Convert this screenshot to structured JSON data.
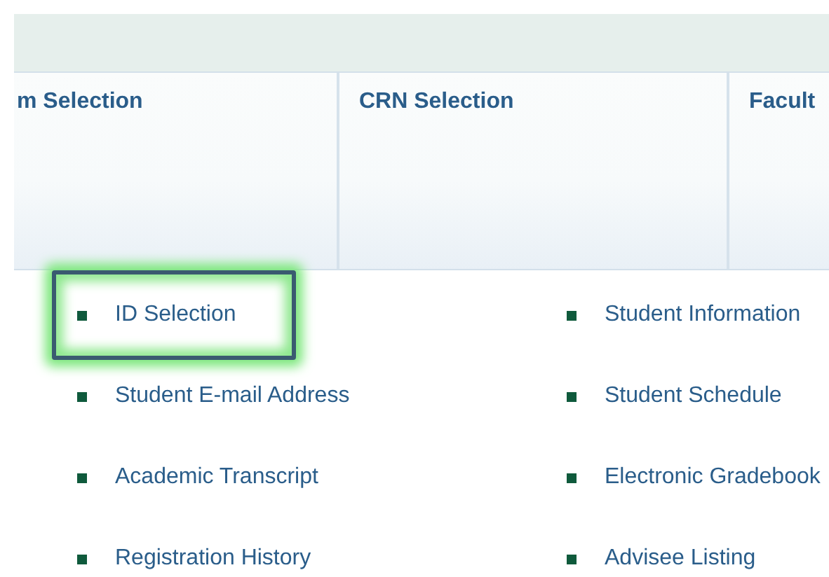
{
  "header_columns": [
    {
      "label": "m Selection"
    },
    {
      "label": "CRN Selection"
    },
    {
      "label": "Facult"
    }
  ],
  "links": [
    {
      "label": "ID Selection",
      "selected": true
    },
    {
      "label": "Student Information",
      "selected": false
    },
    {
      "label": "Student E-mail Address",
      "selected": false
    },
    {
      "label": "Student Schedule",
      "selected": false
    },
    {
      "label": "Academic Transcript",
      "selected": false
    },
    {
      "label": "Electronic Gradebook",
      "selected": false
    },
    {
      "label": "Registration History",
      "selected": false
    },
    {
      "label": "Advisee Listing",
      "selected": false
    }
  ]
}
